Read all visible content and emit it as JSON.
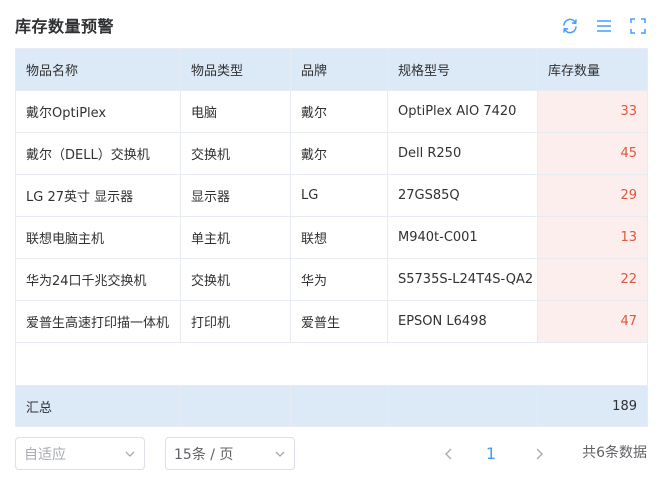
{
  "header": {
    "title": "库存数量预警"
  },
  "toolbar": {
    "refresh_icon": "refresh-icon",
    "columns_icon": "columns-icon",
    "fullscreen_icon": "fullscreen-icon",
    "icon_color": "#409eff"
  },
  "table": {
    "columns": [
      "物品名称",
      "物品类型",
      "品牌",
      "规格型号",
      "库存数量"
    ],
    "rows": [
      {
        "name": "戴尔OptiPlex",
        "type": "电脑",
        "brand": "戴尔",
        "model": "OptiPlex AIO 7420",
        "qty": "33"
      },
      {
        "name": "戴尔（DELL）交换机",
        "type": "交换机",
        "brand": "戴尔",
        "model": "Dell R250",
        "qty": "45"
      },
      {
        "name": "LG 27英寸 显示器",
        "type": "显示器",
        "brand": "LG",
        "model": "27GS85Q",
        "qty": "29"
      },
      {
        "name": "联想电脑主机",
        "type": "单主机",
        "brand": "联想",
        "model": "M940t-C001",
        "qty": "13"
      },
      {
        "name": "华为24口千兆交换机",
        "type": "交换机",
        "brand": "华为",
        "model": "S5735S-L24T4S-QA2",
        "qty": "22"
      },
      {
        "name": "爱普生高速打印描一体机",
        "type": "打印机",
        "brand": "爱普生",
        "model": "EPSON  L6498",
        "qty": "47"
      }
    ],
    "summary": {
      "label": "汇总",
      "total": "189"
    },
    "warning_color": "#e0573d"
  },
  "pager": {
    "size_mode": "自适应",
    "page_size": "15条 / 页",
    "current_page": "1",
    "total_text": "共6条数据"
  }
}
